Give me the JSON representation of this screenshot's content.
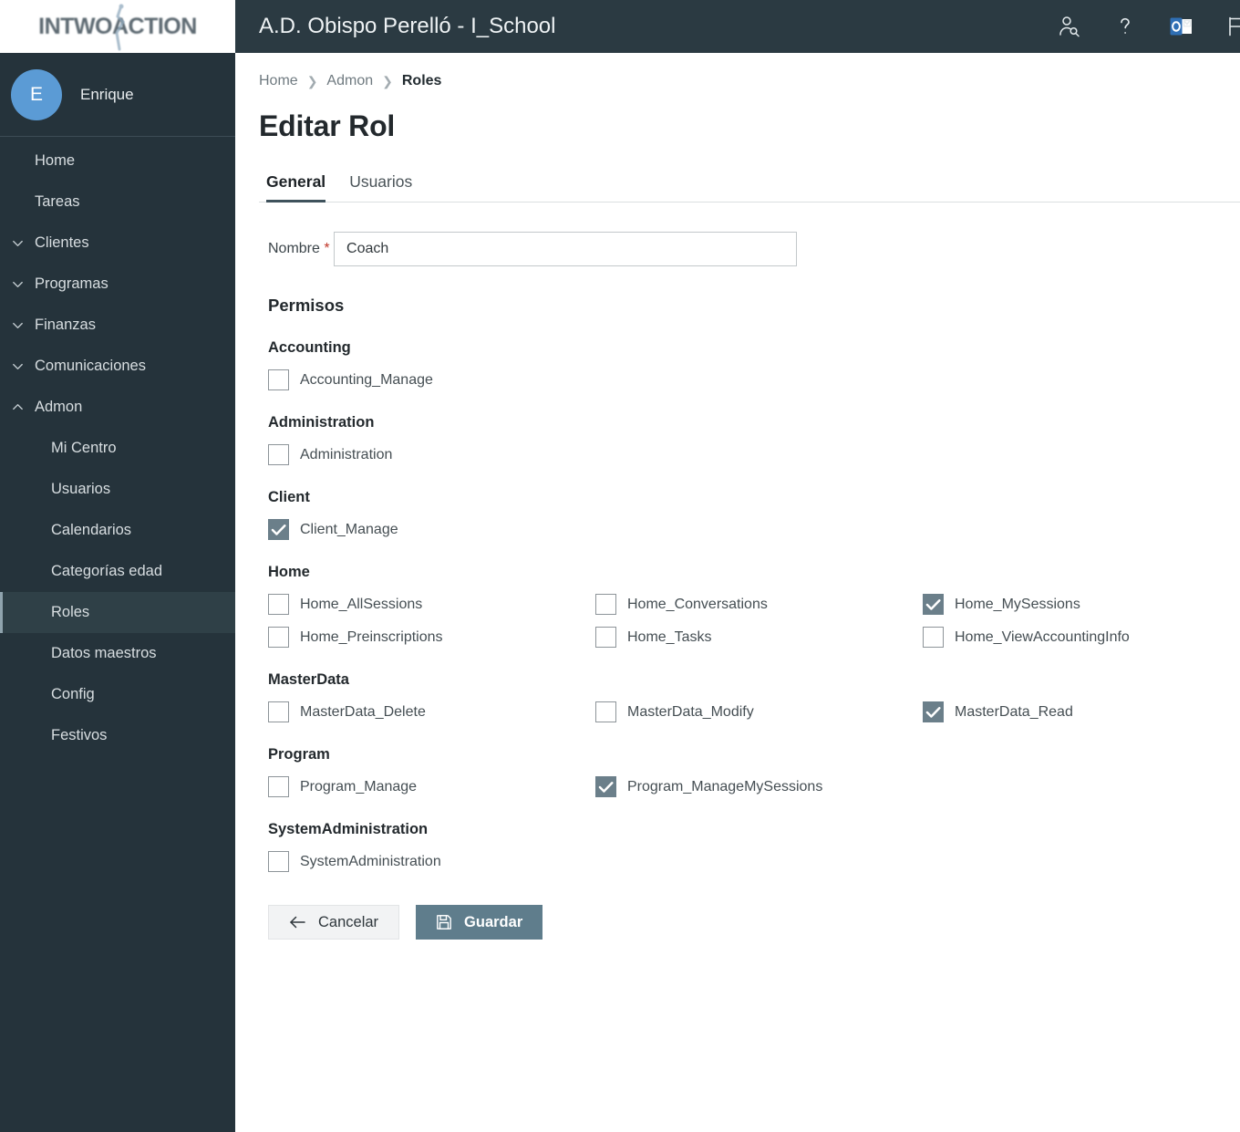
{
  "brand": {
    "logo_text": "INTWOACTION"
  },
  "header": {
    "title": "A.D. Obispo Perelló - I_School",
    "icons": [
      {
        "name": "user-search-icon",
        "label": "user-search-icon"
      },
      {
        "name": "help-icon",
        "label": "help-icon"
      },
      {
        "name": "outlook-icon",
        "label": "outlook-icon"
      },
      {
        "name": "flag-icon",
        "label": "flag-icon"
      }
    ]
  },
  "profile": {
    "initial": "E",
    "name": "Enrique"
  },
  "sidebar": {
    "items": [
      {
        "label": "Home",
        "level": 1,
        "chevron": "none",
        "active": false
      },
      {
        "label": "Tareas",
        "level": 1,
        "chevron": "none",
        "active": false
      },
      {
        "label": "Clientes",
        "level": 1,
        "chevron": "down",
        "active": false
      },
      {
        "label": "Programas",
        "level": 1,
        "chevron": "down",
        "active": false
      },
      {
        "label": "Finanzas",
        "level": 1,
        "chevron": "down",
        "active": false
      },
      {
        "label": "Comunicaciones",
        "level": 1,
        "chevron": "down",
        "active": false
      },
      {
        "label": "Admon",
        "level": 1,
        "chevron": "up",
        "active": false
      },
      {
        "label": "Mi Centro",
        "level": 2,
        "chevron": "none",
        "active": false
      },
      {
        "label": "Usuarios",
        "level": 2,
        "chevron": "none",
        "active": false
      },
      {
        "label": "Calendarios",
        "level": 2,
        "chevron": "none",
        "active": false
      },
      {
        "label": "Categorías edad",
        "level": 2,
        "chevron": "none",
        "active": false
      },
      {
        "label": "Roles",
        "level": 2,
        "chevron": "none",
        "active": true
      },
      {
        "label": "Datos maestros",
        "level": 2,
        "chevron": "none",
        "active": false
      },
      {
        "label": "Config",
        "level": 2,
        "chevron": "none",
        "active": false
      },
      {
        "label": "Festivos",
        "level": 2,
        "chevron": "none",
        "active": false
      }
    ]
  },
  "breadcrumb": [
    {
      "label": "Home",
      "current": false
    },
    {
      "label": "Admon",
      "current": false
    },
    {
      "label": "Roles",
      "current": true
    }
  ],
  "page": {
    "title": "Editar Rol"
  },
  "tabs": [
    {
      "label": "General",
      "active": true
    },
    {
      "label": "Usuarios",
      "active": false
    }
  ],
  "form": {
    "name_label": "Nombre",
    "required_mark": "*",
    "name_value": "Coach",
    "name_placeholder": "",
    "permissions_title": "Permisos"
  },
  "permission_groups": [
    {
      "title": "Accounting",
      "columns": 3,
      "items": [
        {
          "label": "Accounting_Manage",
          "checked": false
        }
      ]
    },
    {
      "title": "Administration",
      "columns": 3,
      "items": [
        {
          "label": "Administration",
          "checked": false
        }
      ]
    },
    {
      "title": "Client",
      "columns": 3,
      "items": [
        {
          "label": "Client_Manage",
          "checked": true
        }
      ]
    },
    {
      "title": "Home",
      "columns": 3,
      "items": [
        {
          "label": "Home_AllSessions",
          "checked": false
        },
        {
          "label": "Home_Conversations",
          "checked": false
        },
        {
          "label": "Home_MySessions",
          "checked": true
        },
        {
          "label": "Home_Preinscriptions",
          "checked": false
        },
        {
          "label": "Home_Tasks",
          "checked": false
        },
        {
          "label": "Home_ViewAccountingInfo",
          "checked": false
        }
      ]
    },
    {
      "title": "MasterData",
      "columns": 3,
      "items": [
        {
          "label": "MasterData_Delete",
          "checked": false
        },
        {
          "label": "MasterData_Modify",
          "checked": false
        },
        {
          "label": "MasterData_Read",
          "checked": true
        }
      ]
    },
    {
      "title": "Program",
      "columns": 3,
      "items": [
        {
          "label": "Program_Manage",
          "checked": false
        },
        {
          "label": "Program_ManageMySessions",
          "checked": true
        }
      ]
    },
    {
      "title": "SystemAdministration",
      "columns": 3,
      "items": [
        {
          "label": "SystemAdministration",
          "checked": false
        }
      ]
    }
  ],
  "actions": {
    "cancel_label": "Cancelar",
    "save_label": "Guardar"
  },
  "colors": {
    "sidebar_bg": "#25333b",
    "header_bg": "#2b3a42",
    "avatar_blue": "#5b9bd5",
    "checkbox_checked": "#6b7f8a",
    "save_button": "#5f7d8c",
    "required_red": "#c0392b",
    "active_nav_bg": "#2f4047"
  }
}
